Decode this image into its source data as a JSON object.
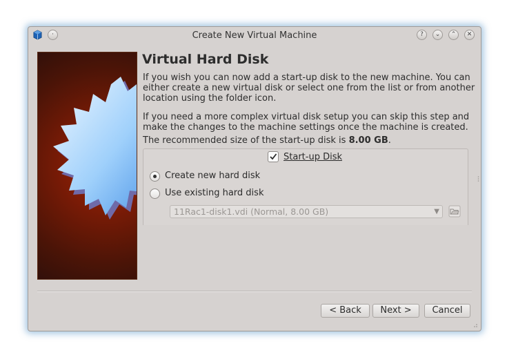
{
  "window": {
    "title": "Create New Virtual Machine",
    "controls": [
      "?",
      "⌄",
      "⌃",
      "✕"
    ]
  },
  "wizard": {
    "heading": "Virtual Hard Disk",
    "paragraph1": "If you wish you can now add a start-up disk to the new machine. You can either create a new virtual disk or select one from the list or from another location using the folder icon.",
    "paragraph2": "If you need a more complex virtual disk setup you can skip this step and make the changes to the machine settings once the machine is created.",
    "recommended_prefix": "The recommended size of the start-up disk is",
    "recommended_size": "8.00 GB",
    "recommended_suffix": ".",
    "startup_disk": {
      "label": "Start-up Disk",
      "checked": true
    },
    "create_new": {
      "label": "Create new hard disk",
      "selected": true
    },
    "use_existing": {
      "label": "Use existing hard disk",
      "selected": false
    },
    "existing_disk_value": "11Rac1-disk1.vdi (Normal, 8.00 GB)"
  },
  "buttons": {
    "back": "< Back",
    "next": "Next >",
    "cancel": "Cancel"
  },
  "icons": {
    "app": "virtualbox-icon",
    "folder": "folder-open-icon"
  }
}
